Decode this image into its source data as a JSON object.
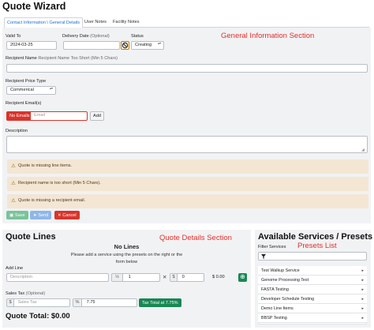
{
  "title": "Quote Wizard",
  "tabs": [
    {
      "label": "Contact Information \\ General Details"
    },
    {
      "label": "User Notes"
    },
    {
      "label": "Facility Notes"
    }
  ],
  "general": {
    "annotation": "General Information Section",
    "valid_to_label": "Valid To",
    "valid_to_value": "2024-03-25",
    "delivery_date_label": "Delivery Date",
    "optional_text": "(Optional)",
    "status_label": "Status",
    "status_value": "Creating",
    "recipient_name_label": "Recipient Name",
    "recipient_name_hint": "Recipient Name Too Short (Min 5 Chars)",
    "recipient_name_value": "",
    "price_type_label": "Recipient Price Type",
    "price_type_value": "Commerical",
    "emails_label": "Recipient Email(s)",
    "no_emails_badge": "No Emails",
    "email_placeholder": "Email",
    "add_label": "Add",
    "description_label": "Description",
    "description_value": "",
    "alerts": [
      "Quote is missing line items.",
      "Recipient name is too short (Min 5 Chars).",
      "Quote is missing a recipient email."
    ],
    "save_label": "Save",
    "send_label": "Send",
    "cancel_label": "Cancel"
  },
  "quote_lines": {
    "title": "Quote Lines",
    "annotation": "Quote Details Section",
    "no_lines_title": "No Lines",
    "no_lines_text_1": "Please add a service using the presets on the right or the",
    "no_lines_text_2": "form below",
    "add_line_label": "Add Line",
    "description_placeholder": "Description",
    "quantity_value": "1",
    "price_value": "0",
    "line_total": "$ 0.00",
    "sales_tax_label": "Sales Tax",
    "sales_tax_optional": "(Optional)",
    "sales_tax_placeholder": "Sales Tax",
    "tax_percent_value": "7.75",
    "tax_total_badge": "Tax Total at 7.75%",
    "quote_total": "Quote Total: $0.00"
  },
  "services": {
    "title": "Available Services / Presets",
    "annotation": "Presets List",
    "filter_label": "Filter Services",
    "items": [
      {
        "label": "Test Walkup Service"
      },
      {
        "label": "Genome Processing Test"
      },
      {
        "label": "FASTA Testing"
      },
      {
        "label": "Developer Schedule Testing"
      },
      {
        "label": "Demo Line Items"
      },
      {
        "label": "BBSP Testing"
      }
    ]
  },
  "colors": {
    "accent_blue": "#1d6fd6",
    "danger": "#d9342b",
    "success": "#198754",
    "annotation_red": "#e0312b",
    "warning_bg": "#f3e6d2"
  }
}
